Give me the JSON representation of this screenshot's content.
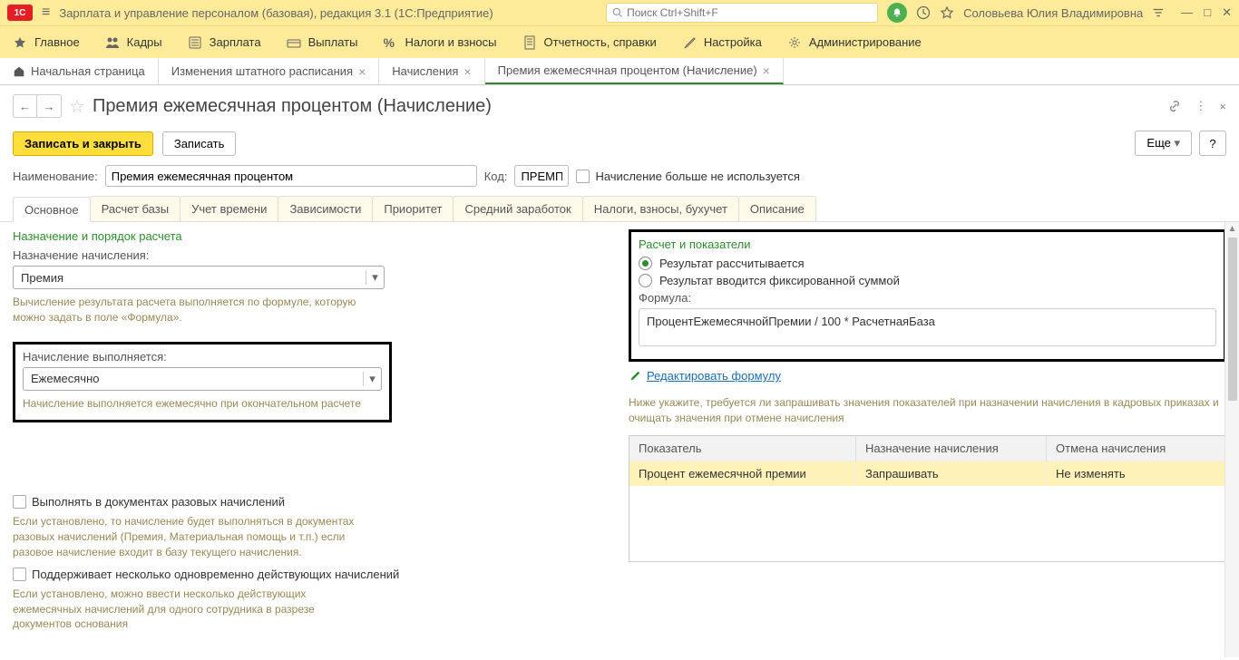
{
  "titlebar": {
    "app_title": "Зарплата и управление персоналом (базовая), редакция 3.1  (1С:Предприятие)",
    "search_placeholder": "Поиск Ctrl+Shift+F",
    "user": "Соловьева Юлия Владимировна"
  },
  "menu": {
    "main": "Главное",
    "hr": "Кадры",
    "salary": "Зарплата",
    "payments": "Выплаты",
    "taxes": "Налоги и взносы",
    "reports": "Отчетность, справки",
    "settings": "Настройка",
    "admin": "Администрирование"
  },
  "tabs": {
    "home": "Начальная страница",
    "t1": "Изменения штатного расписания",
    "t2": "Начисления",
    "t3": "Премия ежемесячная процентом (Начисление)"
  },
  "page": {
    "title": "Премия ежемесячная процентом (Начисление)"
  },
  "cmd": {
    "save_close": "Записать и закрыть",
    "save": "Записать",
    "more": "Еще",
    "help": "?"
  },
  "fields": {
    "name_label": "Наименование:",
    "name_value": "Премия ежемесячная процентом",
    "code_label": "Код:",
    "code_value": "ПРЕМП",
    "not_used": "Начисление больше не используется"
  },
  "inner_tabs": {
    "main": "Основное",
    "base": "Расчет базы",
    "time": "Учет времени",
    "deps": "Зависимости",
    "priority": "Приоритет",
    "avg": "Средний заработок",
    "tax": "Налоги, взносы, бухучет",
    "desc": "Описание"
  },
  "left": {
    "section1": "Назначение и порядок расчета",
    "purpose_label": "Назначение начисления:",
    "purpose_value": "Премия",
    "purpose_help": "Вычисление результата расчета выполняется по формуле, которую можно задать в поле «Формула».",
    "exec_label": "Начисление выполняется:",
    "exec_value": "Ежемесячно",
    "exec_help": "Начисление выполняется ежемесячно при окончательном расчете",
    "cb1": "Выполнять в документах разовых начислений",
    "cb1_help": "Если установлено, то начисление будет выполняться в документах разовых начислений (Премия, Материальная помощь и т.п.) если разовое начисление входит в базу текущего начисления.",
    "cb2": "Поддерживает несколько одновременно действующих начислений",
    "cb2_help": "Если установлено, можно ввести несколько действующих ежемесячных начислений для одного сотрудника в разрезе документов основания"
  },
  "right": {
    "section": "Расчет и показатели",
    "radio1": "Результат рассчитывается",
    "radio2": "Результат вводится фиксированной суммой",
    "formula_label": "Формула:",
    "formula_value": "ПроцентЕжемесячнойПремии / 100 * РасчетнаяБаза",
    "edit_link": "Редактировать формулу",
    "hint": "Ниже укажите, требуется ли запрашивать значения показателей при назначении начисления в кадровых приказах и очищать значения при отмене начисления",
    "th1": "Показатель",
    "th2": "Назначение начисления",
    "th3": "Отмена начисления",
    "td1": "Процент ежемесячной премии",
    "td2": "Запрашивать",
    "td3": "Не изменять"
  }
}
